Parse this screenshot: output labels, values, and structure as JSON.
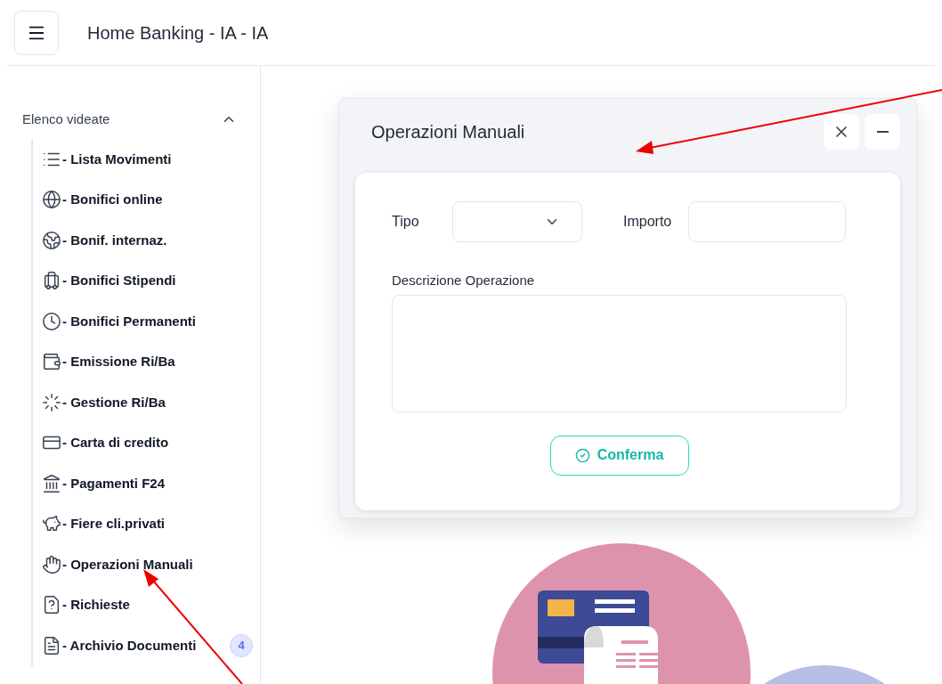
{
  "header": {
    "title": "Home Banking - IA - IA"
  },
  "sidebar": {
    "section": {
      "title": "Elenco videate",
      "expanded": true
    },
    "items": [
      {
        "label": "- Lista Movimenti"
      },
      {
        "label": "- Bonifici online"
      },
      {
        "label": "- Bonif. internaz."
      },
      {
        "label": "- Bonifici Stipendi"
      },
      {
        "label": "- Bonifici Permanenti"
      },
      {
        "label": "- Emissione Ri/Ba"
      },
      {
        "label": "- Gestione Ri/Ba"
      },
      {
        "label": "- Carta di credito"
      },
      {
        "label": "- Pagamenti F24"
      },
      {
        "label": "- Fiere cli.privati"
      },
      {
        "label": "- Operazioni Manuali"
      },
      {
        "label": "- Richieste"
      },
      {
        "label": "- Archivio Documenti",
        "badge": "4"
      }
    ]
  },
  "dialog": {
    "title": "Operazioni Manuali",
    "fields": {
      "tipo_label": "Tipo",
      "importo_label": "Importo",
      "descrizione_label": "Descrizione Operazione"
    },
    "confirm_button": "Conferma"
  }
}
